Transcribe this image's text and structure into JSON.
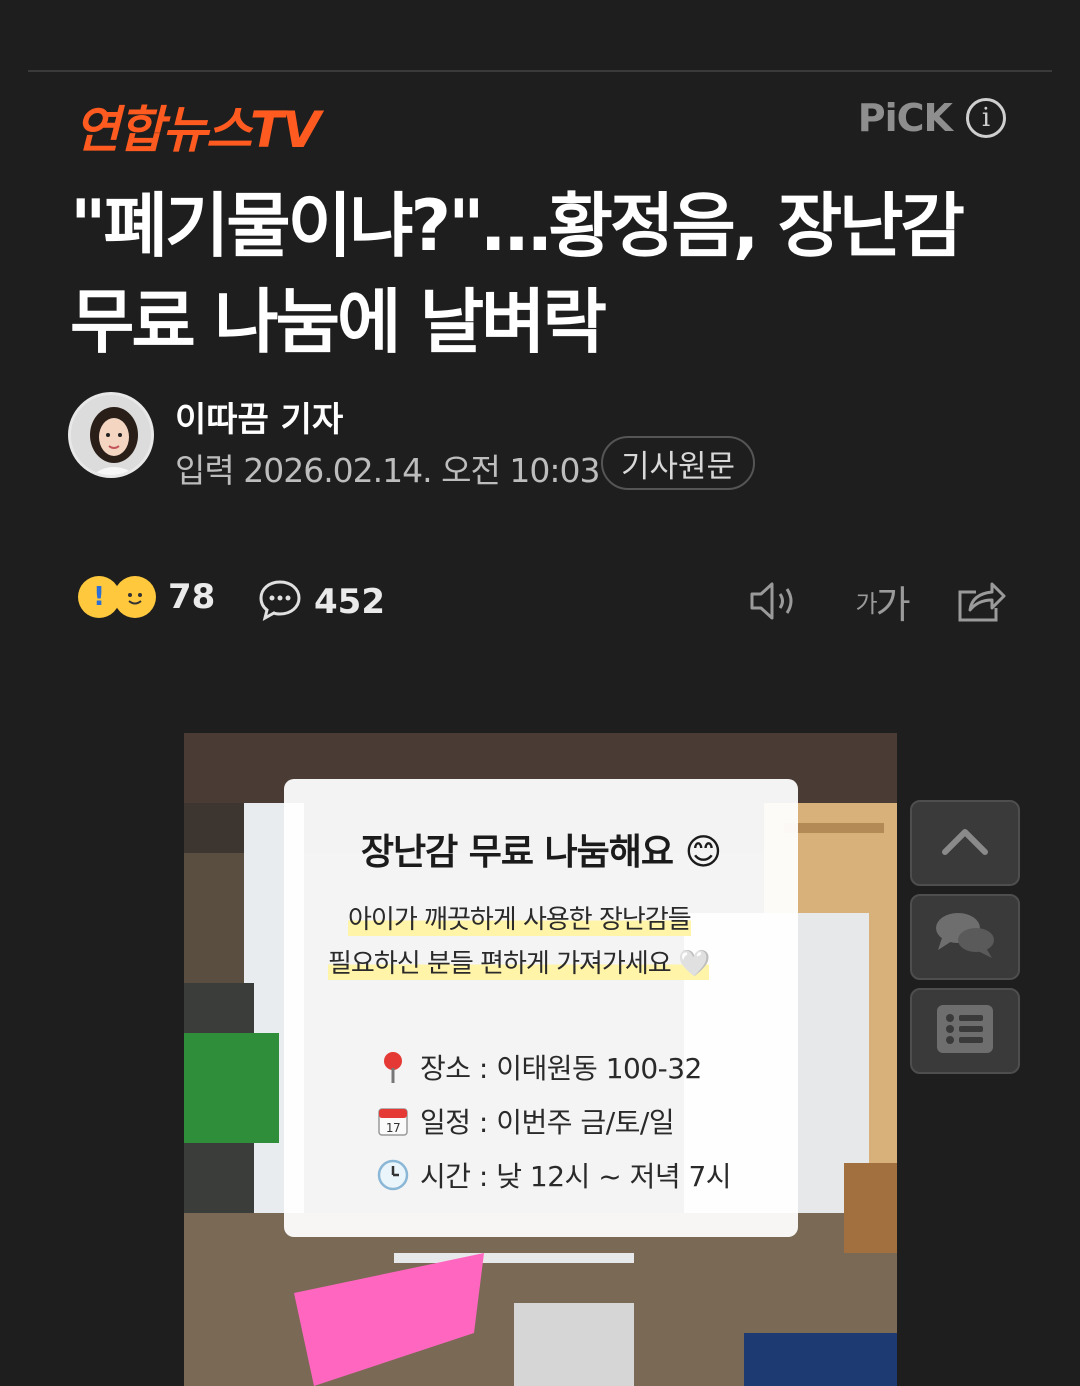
{
  "header": {
    "press_name": "연합뉴스TV",
    "pick_label": "PiCK",
    "info_icon": "info-icon"
  },
  "article": {
    "headline": "\"폐기물이냐?\"…황정음, 장난감 무료 나눔에 날벼락",
    "reporter": "이따끔 기자",
    "date_line": "입력 2026.02.14. 오전 10:03",
    "original_button": "기사원문"
  },
  "actions": {
    "reaction_count": "78",
    "comment_count": "452",
    "icons": [
      "speaker-icon",
      "font-size-icon",
      "share-icon"
    ],
    "font_icon_small": "가",
    "font_icon_large": "가"
  },
  "photo_notice": {
    "title": "장난감 무료 나눔해요 😊",
    "line1": "아이가 깨끗하게 사용한 장난감들",
    "line2": "필요하신 분들 편하게 가져가세요 🤍",
    "place": "장소 : 이태원동 100-32",
    "schedule": "일정 : 이번주 금/토/일",
    "time": "시간 : 낮 12시 ~ 저녁 7시"
  },
  "side_buttons": [
    "scroll-top-icon",
    "comment-bubbles-icon",
    "list-icon"
  ],
  "colors": {
    "background": "#1e1e1e",
    "press_brand": "#ff5a1f",
    "highlight": "#fff4a8"
  }
}
